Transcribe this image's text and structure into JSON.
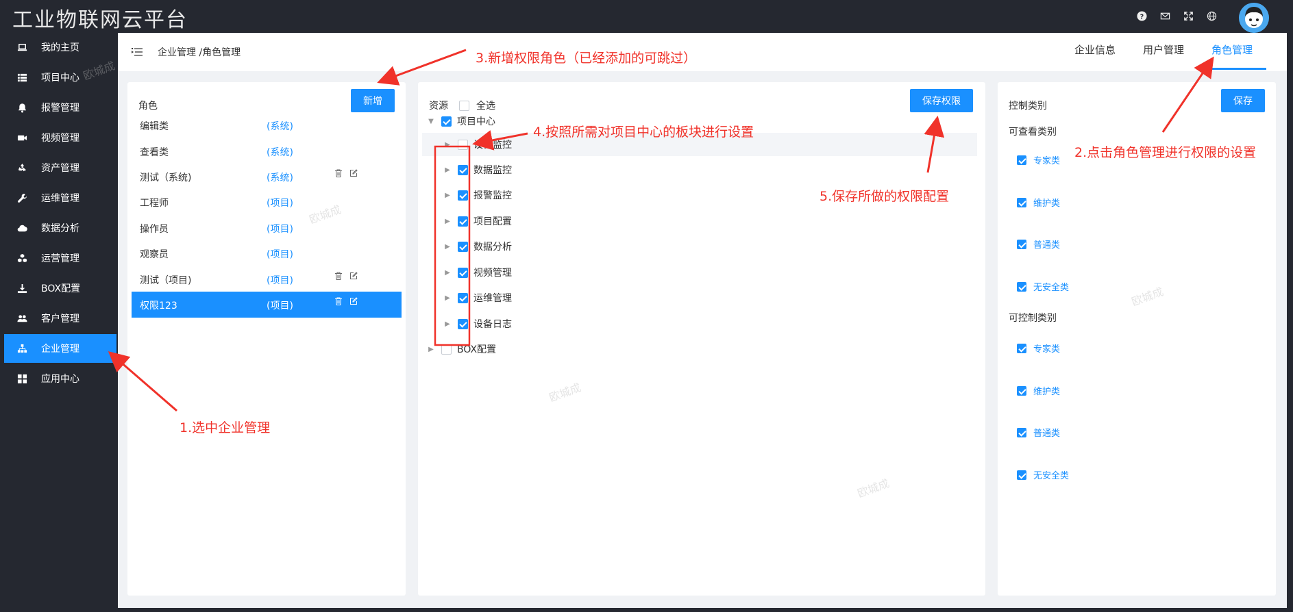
{
  "app": {
    "title": "工业物联网云平台"
  },
  "topbar": {
    "icons": [
      "help-icon",
      "mail-icon",
      "fullscreen-icon",
      "globe-icon"
    ]
  },
  "sidebar": {
    "items": [
      {
        "label": "我的主页",
        "icon": "laptop-icon"
      },
      {
        "label": "项目中心",
        "icon": "list-icon"
      },
      {
        "label": "报警管理",
        "icon": "bell-icon"
      },
      {
        "label": "视频管理",
        "icon": "video-icon"
      },
      {
        "label": "资产管理",
        "icon": "recycle-icon"
      },
      {
        "label": "运维管理",
        "icon": "wrench-icon"
      },
      {
        "label": "数据分析",
        "icon": "cloud-icon"
      },
      {
        "label": "运营管理",
        "icon": "cubes-icon"
      },
      {
        "label": "BOX配置",
        "icon": "download-icon"
      },
      {
        "label": "客户管理",
        "icon": "users-icon"
      },
      {
        "label": "企业管理",
        "icon": "sitemap-icon",
        "active": true
      },
      {
        "label": "应用中心",
        "icon": "grid-icon"
      }
    ]
  },
  "header": {
    "breadcrumb": "企业管理 /角色管理",
    "tabs": [
      {
        "label": "企业信息"
      },
      {
        "label": "用户管理"
      },
      {
        "label": "角色管理",
        "active": true
      }
    ]
  },
  "roles": {
    "title": "角色",
    "add_label": "新增",
    "items": [
      {
        "name": "编辑类",
        "type": "(系统)"
      },
      {
        "name": "查看类",
        "type": "(系统)"
      },
      {
        "name": "测试（系统)",
        "type": "(系统)",
        "editable": true
      },
      {
        "name": "工程师",
        "type": "(项目)"
      },
      {
        "name": "操作员",
        "type": "(项目)"
      },
      {
        "name": "观察员",
        "type": "(项目)"
      },
      {
        "name": "测试（项目)",
        "type": "(项目)",
        "editable": true
      },
      {
        "name": "权限123",
        "type": "(项目)",
        "editable": true,
        "selected": true
      }
    ]
  },
  "resources": {
    "title": "资源",
    "select_all_label": "全选",
    "save_label": "保存权限",
    "root": {
      "label": "项目中心",
      "checked": true
    },
    "children": [
      {
        "label": "设备监控",
        "checked": false
      },
      {
        "label": "数据监控",
        "checked": true
      },
      {
        "label": "报警监控",
        "checked": true
      },
      {
        "label": "项目配置",
        "checked": true
      },
      {
        "label": "数据分析",
        "checked": true
      },
      {
        "label": "视频管理",
        "checked": true
      },
      {
        "label": "运维管理",
        "checked": true
      },
      {
        "label": "设备日志",
        "checked": true
      }
    ],
    "second_root": {
      "label": "BOX配置",
      "checked": false
    }
  },
  "control": {
    "title": "控制类别",
    "save_label": "保存",
    "viewable_title": "可查看类别",
    "viewable": [
      "专家类",
      "维护类",
      "普通类",
      "无安全类"
    ],
    "controllable_title": "可控制类别",
    "controllable": [
      "专家类",
      "维护类",
      "普通类",
      "无安全类"
    ]
  },
  "annotations": {
    "step1": "1.选中企业管理",
    "step2": "2.点击角色管理进行权限的设置",
    "step3": "3.新增权限角色（已经添加的可跳过）",
    "step4": "4.按照所需对项目中心的板块进行设置",
    "step5": "5.保存所做的权限配置"
  },
  "watermark": "欧城成",
  "colors": {
    "primary": "#1a90ff",
    "annotation": "#f0322a",
    "sidebar_bg": "#252830"
  }
}
